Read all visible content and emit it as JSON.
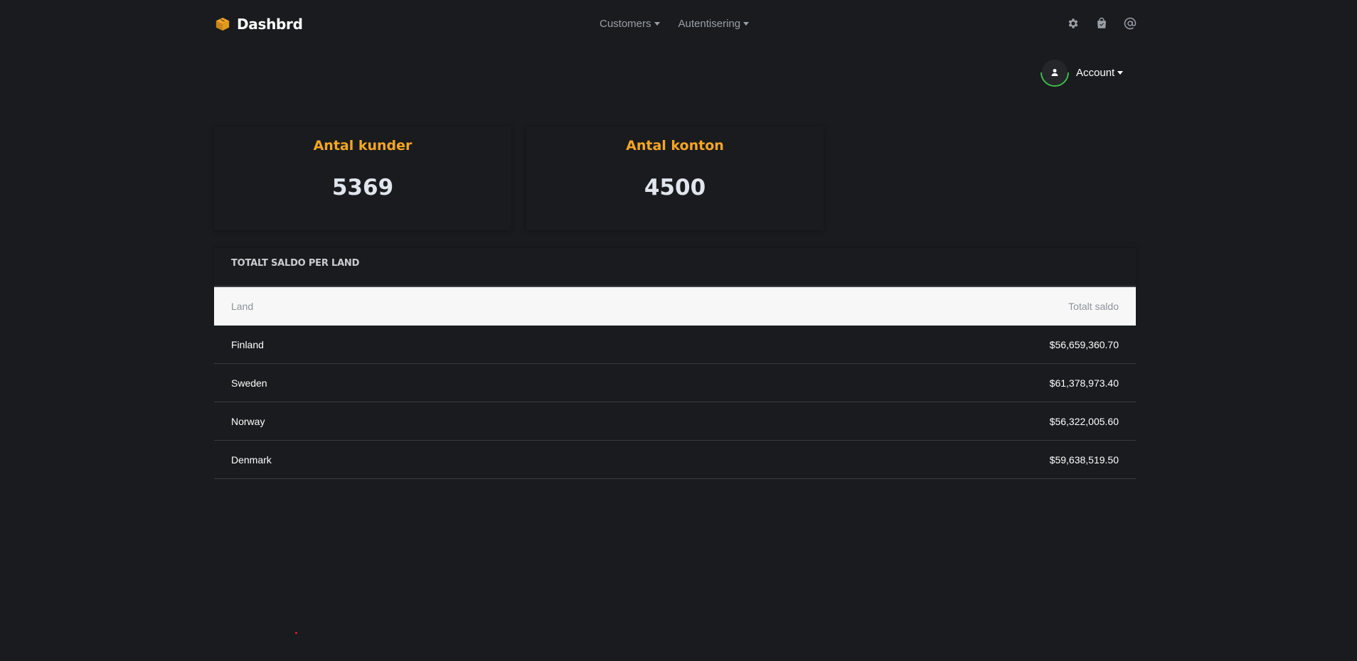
{
  "navbar": {
    "brand": "Dashbrd",
    "links": [
      {
        "label": "Customers"
      },
      {
        "label": "Autentisering"
      }
    ],
    "icons": [
      "gear-icon",
      "shopping-bag-icon",
      "at-sign-icon"
    ]
  },
  "account": {
    "label": "Account"
  },
  "stats": [
    {
      "title": "Antal kunder",
      "value": "5369"
    },
    {
      "title": "Antal konton",
      "value": "4500"
    }
  ],
  "balance_table": {
    "heading": "TOTALT SALDO PER LAND",
    "columns": [
      "Land",
      "Totalt saldo"
    ],
    "rows": [
      {
        "country": "Finland",
        "balance": "$56,659,360.70"
      },
      {
        "country": "Sweden",
        "balance": "$61,378,973.40"
      },
      {
        "country": "Norway",
        "balance": "$56,322,005.60"
      },
      {
        "country": "Denmark",
        "balance": "$59,638,519.50"
      }
    ]
  },
  "colors": {
    "background": "#1a1b1e",
    "accent": "#f5a623",
    "avatar_ring": "#3cc24a"
  }
}
